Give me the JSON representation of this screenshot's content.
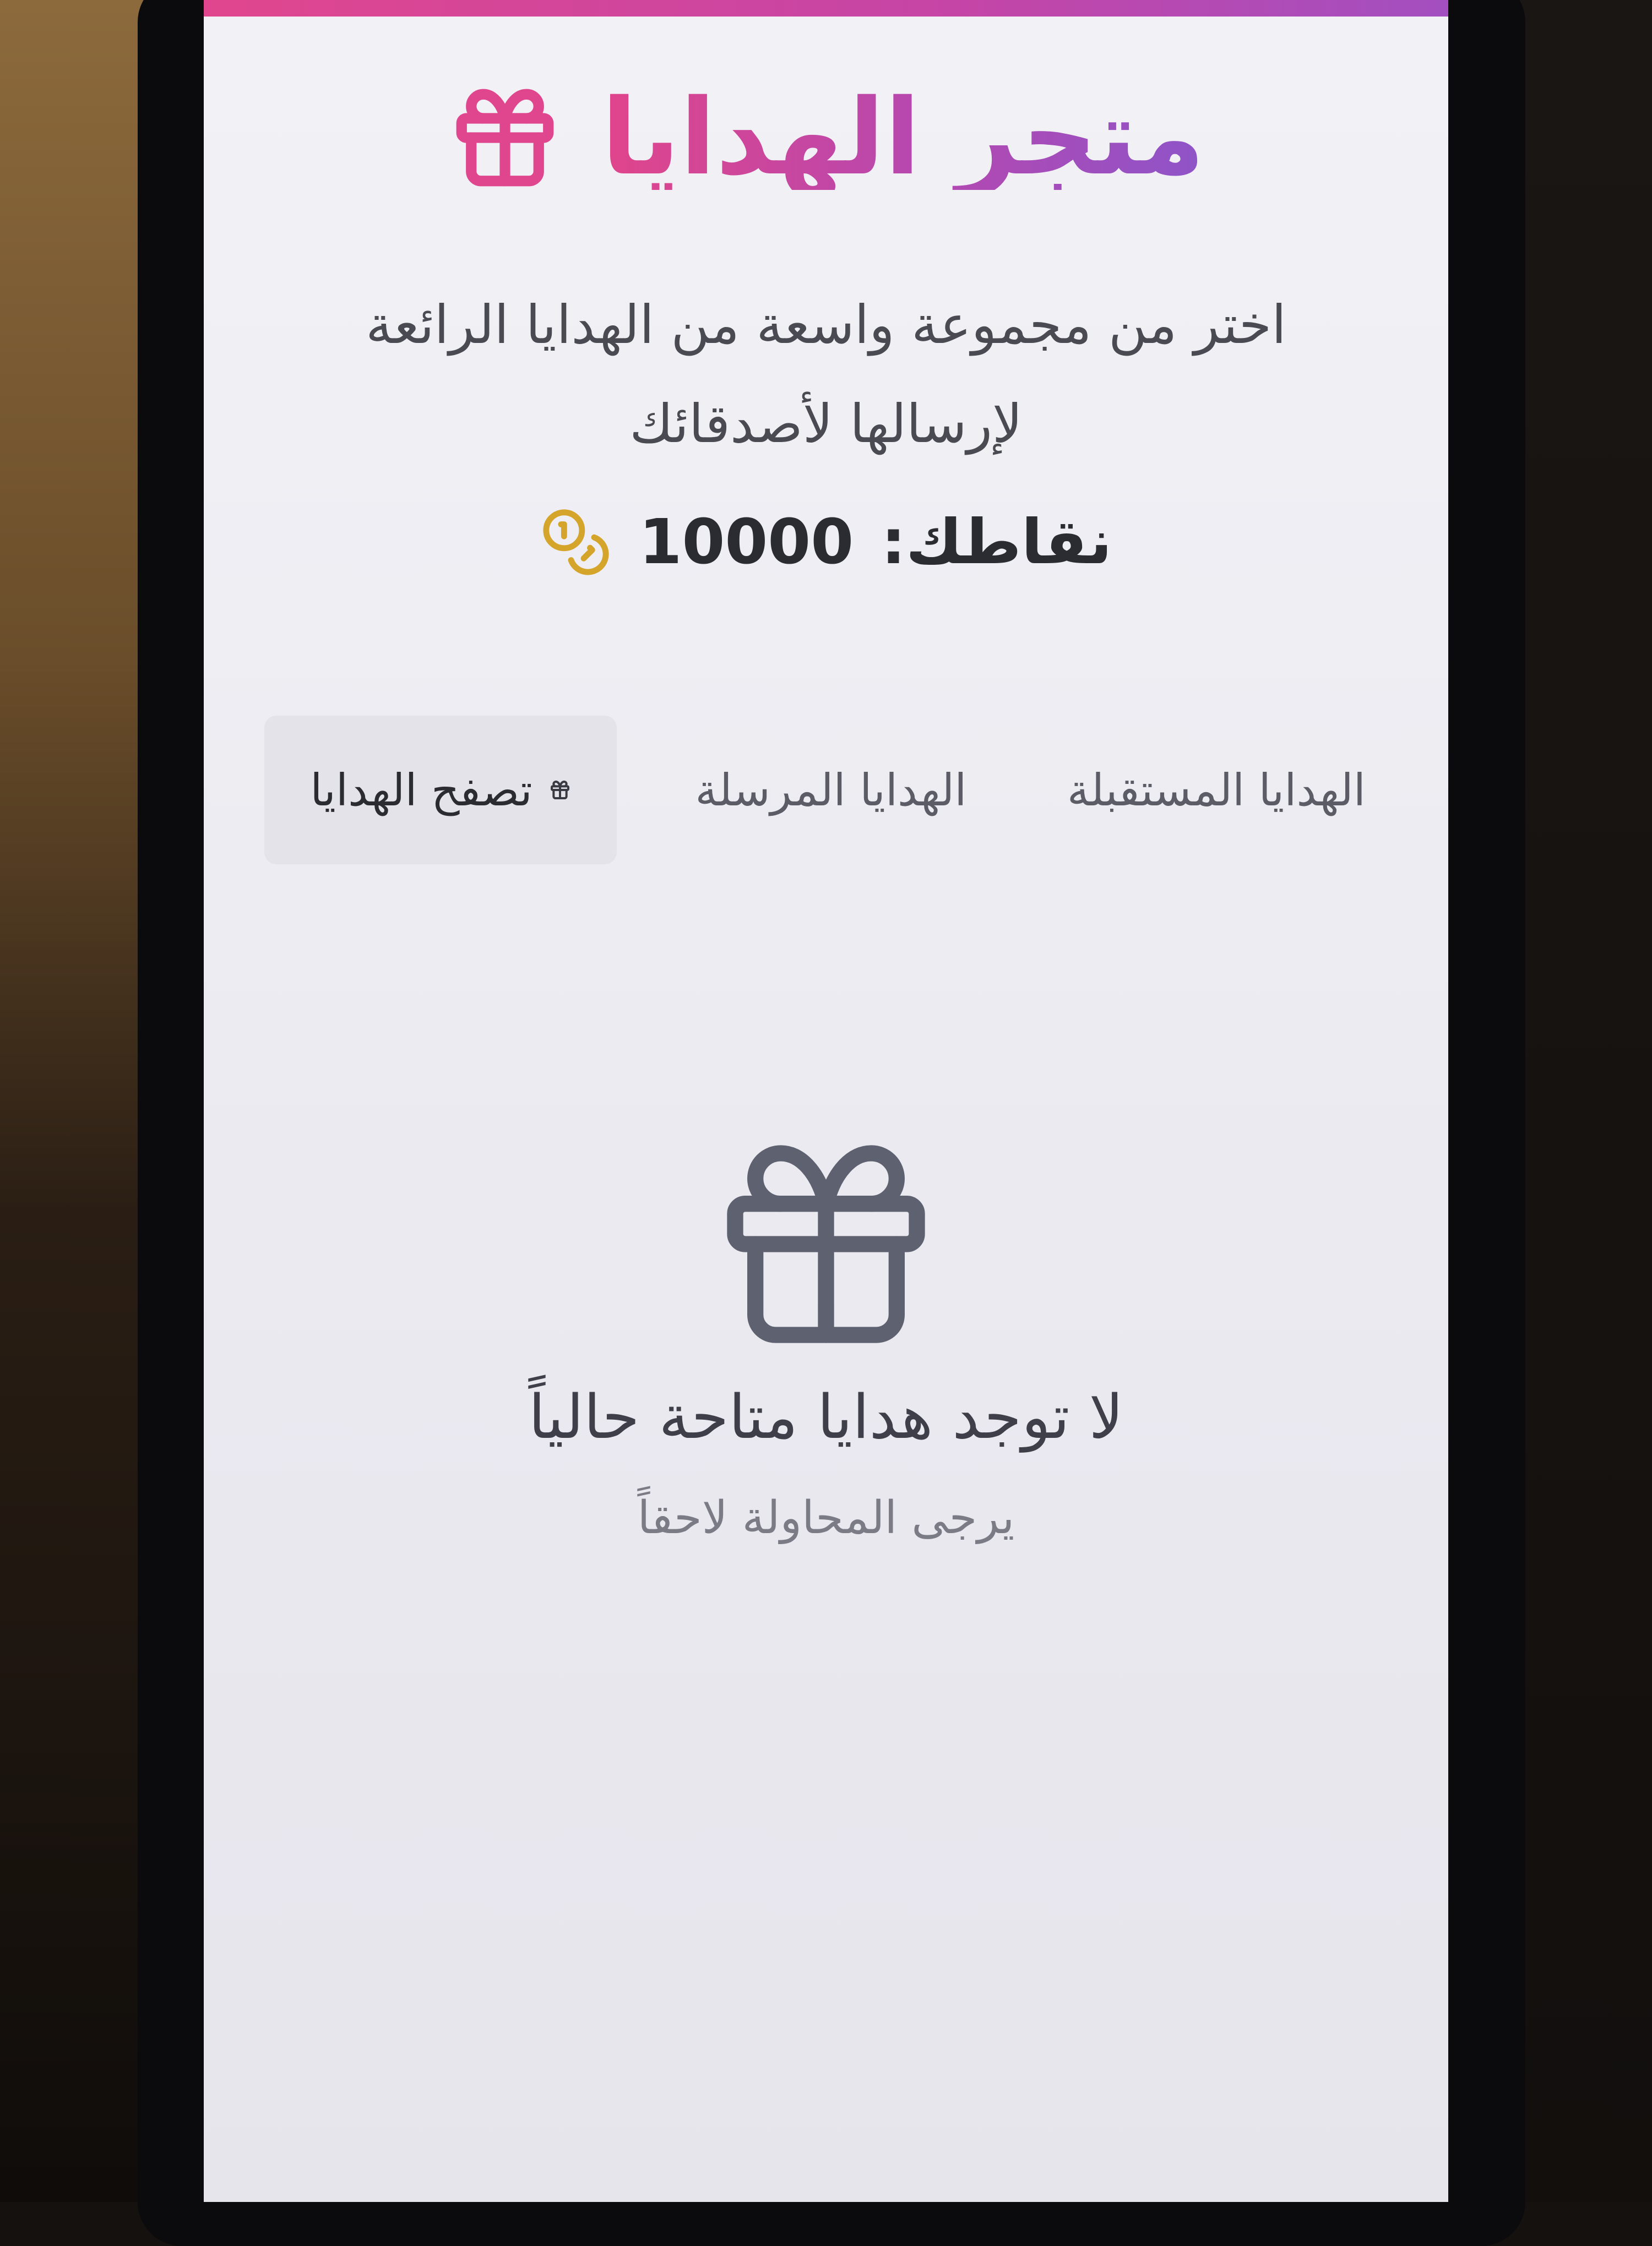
{
  "header": {
    "title": "متجر الهدايا",
    "title_icon": "gift-icon"
  },
  "subtitle": "اختر من مجموعة واسعة من الهدايا الرائعة لإرسالها لأصدقائك",
  "points": {
    "label": "نقاطك:",
    "value": "10000",
    "icon": "coins-icon"
  },
  "tabs": [
    {
      "label": "الهدايا المستقبلة",
      "active": false
    },
    {
      "label": "الهدايا المرسلة",
      "active": false
    },
    {
      "label": "تصفح الهدايا",
      "active": true,
      "icon": "gift-icon"
    }
  ],
  "empty_state": {
    "icon": "gift-icon",
    "title": "لا توجد هدايا متاحة حالياً",
    "subtitle": "يرجى المحاولة لاحقاً"
  },
  "colors": {
    "accent_pink": "#e0458b",
    "accent_purple": "#8e54c8",
    "coin_gold": "#d4a52a",
    "text_dark": "#2b2b32",
    "text_muted": "#7a7b85"
  }
}
